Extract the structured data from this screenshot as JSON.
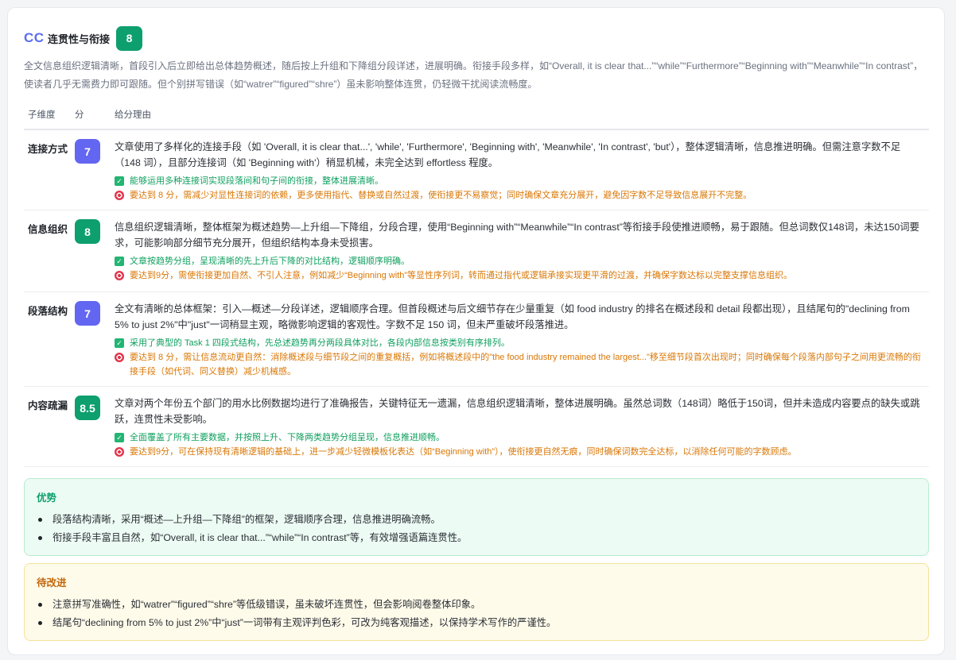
{
  "section": {
    "tag": "CC",
    "title": "连贯性与衔接",
    "score": "8",
    "summary": "全文信息组织逻辑清晰，首段引入后立即给出总体趋势概述，随后按上升组和下降组分段详述，进展明确。衔接手段多样，如“Overall, it is clear that...”“while”“Furthermore”“Beginning with”“Meanwhile”“In contrast”，使读者几乎无需费力即可跟随。但个别拼写错误（如“watrer”“figured”“shre”）虽未影响整体连贯，仍轻微干扰阅读流畅度。"
  },
  "table": {
    "headers": {
      "dimension": "子维度",
      "score": "分",
      "reason": "给分理由"
    },
    "rows": [
      {
        "name": "连接方式",
        "score": "7",
        "color": "#6366f1",
        "reason": "文章使用了多样化的连接手段（如 'Overall, it is clear that...', 'while', 'Furthermore', 'Beginning with', 'Meanwhile', 'In contrast', 'but'），整体逻辑清晰，信息推进明确。但需注意字数不足（148 词），且部分连接词（如 'Beginning with'）稍显机械，未完全达到 effortless 程度。",
        "strength": "能够运用多种连接词实现段落间和句子间的衔接，整体进展清晰。",
        "target": "要达到 8 分，需减少对显性连接词的依赖，更多使用指代、替换或自然过渡，使衔接更不易察觉；同时确保文章充分展开，避免因字数不足导致信息展开不完整。"
      },
      {
        "name": "信息组织",
        "score": "8",
        "color": "#0e9f6e",
        "reason": "信息组织逻辑清晰，整体框架为概述趋势—上升组—下降组，分段合理，使用“Beginning with”“Meanwhile”“In contrast”等衔接手段使推进顺畅，易于跟随。但总词数仅148词，未达150词要求，可能影响部分细节充分展开，但组织结构本身未受损害。",
        "strength": "文章按趋势分组，呈现清晰的先上升后下降的对比结构，逻辑顺序明确。",
        "target": "要达到9分，需使衔接更加自然、不引人注意，例如减少“Beginning with”等显性序列词，转而通过指代或逻辑承接实现更平滑的过渡，并确保字数达标以完整支撑信息组织。"
      },
      {
        "name": "段落结构",
        "score": "7",
        "color": "#6366f1",
        "reason": "全文有清晰的总体框架：引入—概述—分段详述，逻辑顺序合理。但首段概述与后文细节存在少量重复（如 food industry 的排名在概述段和 detail 段都出现），且结尾句的\"declining from 5% to just 2%\"中\"just\"一词稍显主观，略微影响逻辑的客观性。字数不足 150 词，但未严重破坏段落推进。",
        "strength": "采用了典型的 Task 1 四段式结构，先总述趋势再分两段具体对比，各段内部信息按类别有序排列。",
        "target": "要达到 8 分，需让信息流动更自然：消除概述段与细节段之间的重复概括，例如将概述段中的\"the food industry remained the largest...\"移至细节段首次出现时；同时确保每个段落内部句子之间用更流畅的衔接手段（如代词、同义替换）减少机械感。"
      },
      {
        "name": "内容疏漏",
        "score": "8.5",
        "color": "#0e9f6e",
        "reason": "文章对两个年份五个部门的用水比例数据均进行了准确报告，关键特征无一遗漏，信息组织逻辑清晰，整体进展明确。虽然总词数（148词）略低于150词，但并未造成内容要点的缺失或跳跃，连贯性未受影响。",
        "strength": "全面覆盖了所有主要数据，并按照上升、下降两类趋势分组呈现，信息推进顺畅。",
        "target": "要达到9分，可在保持现有清晰逻辑的基础上，进一步减少轻微模板化表达（如“Beginning with”），使衔接更自然无痕，同时确保词数完全达标，以消除任何可能的字数顾虑。"
      }
    ]
  },
  "strengths": {
    "title": "优势",
    "items": [
      "段落结构清晰，采用“概述—上升组—下降组”的框架，逻辑顺序合理，信息推进明确流畅。",
      "衔接手段丰富且自然，如“Overall, it is clear that...”“while”“In contrast”等，有效增强语篇连贯性。"
    ]
  },
  "improvements": {
    "title": "待改进",
    "items": [
      "注意拼写准确性，如“watrer”“figured”“shre”等低级错误，虽未破坏连贯性，但会影响阅卷整体印象。",
      "结尾句“declining from 5% to just 2%”中“just”一词带有主观评判色彩，可改为纯客观描述，以保持学术写作的严谨性。"
    ]
  }
}
